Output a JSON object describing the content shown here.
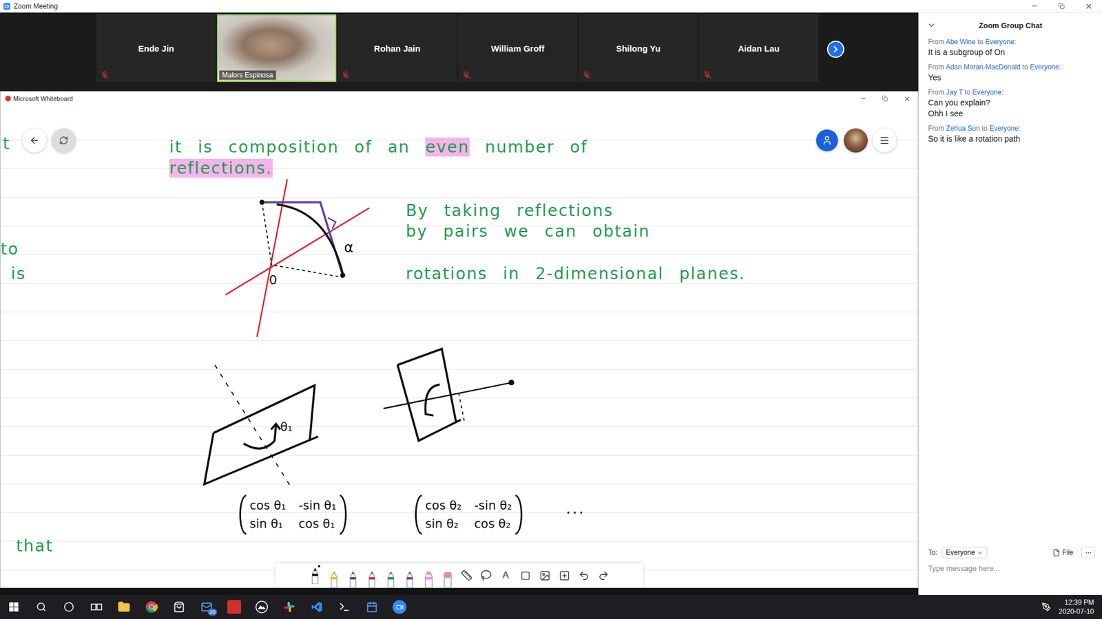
{
  "window": {
    "title": "Zoom Meeting"
  },
  "participants": [
    {
      "name": "Ende Jin",
      "muted": true,
      "video": false,
      "speaking": false
    },
    {
      "name": "Malors Espinosa",
      "muted": false,
      "video": true,
      "speaking": true
    },
    {
      "name": "Rohan Jain",
      "muted": true,
      "video": false,
      "speaking": false
    },
    {
      "name": "William Groff",
      "muted": true,
      "video": false,
      "speaking": false
    },
    {
      "name": "Shilong Yu",
      "muted": true,
      "video": false,
      "speaking": false
    },
    {
      "name": "Aidan Lau",
      "muted": true,
      "video": false,
      "speaking": false
    }
  ],
  "whiteboard": {
    "title": "Microsoft Whiteboard",
    "notes": [
      {
        "segments": [
          {
            "text": "t",
            "highlighted": false
          }
        ]
      },
      {
        "segments": [
          {
            "text": "it is composition of an",
            "highlighted": false
          },
          {
            "text": "even",
            "highlighted": true
          },
          {
            "text": "number of",
            "highlighted": false
          }
        ]
      },
      {
        "segments": [
          {
            "text": "reflections.",
            "highlighted": true
          }
        ]
      },
      {
        "segments": [
          {
            "text": "to",
            "highlighted": false
          }
        ]
      },
      {
        "segments": [
          {
            "text": "is",
            "highlighted": false
          }
        ]
      },
      {
        "segments": [
          {
            "text": "By taking reflections",
            "highlighted": false
          }
        ]
      },
      {
        "segments": [
          {
            "text": "by pairs we can obtain",
            "highlighted": false
          }
        ]
      },
      {
        "segments": [
          {
            "text": "rotations in 2-dimensional planes.",
            "highlighted": false
          }
        ]
      },
      {
        "segments": [
          {
            "text": "that",
            "highlighted": false
          }
        ]
      }
    ],
    "diagram_labels": {
      "angle": "α",
      "origin": "0",
      "rotation": "θ₁"
    },
    "matrices": [
      {
        "cells": [
          "cos θ₁",
          "-sin θ₁",
          "sin θ₁",
          "cos θ₁"
        ]
      },
      {
        "cells": [
          "cos θ₂",
          "-sin θ₂",
          "sin θ₂",
          "cos θ₂"
        ]
      }
    ],
    "ellipsis": "...",
    "tools": {
      "pens": [
        {
          "kind": "pen",
          "color": "#111111",
          "selected": true
        },
        {
          "kind": "pen",
          "color": "#f2c200",
          "selected": false
        },
        {
          "kind": "pen",
          "color": "#5b3fa6",
          "selected": false
        },
        {
          "kind": "pen",
          "color": "#d92a2a",
          "selected": false
        },
        {
          "kind": "pen",
          "color": "#1e9e4e",
          "selected": false
        },
        {
          "kind": "pen",
          "color": "#7b3fb0",
          "selected": false
        },
        {
          "kind": "highlighter",
          "color": "#f08fd8",
          "selected": false
        },
        {
          "kind": "eraser",
          "color": "#e88aa8",
          "selected": false
        }
      ],
      "text_tool": "A"
    }
  },
  "chat": {
    "title": "Zoom Group Chat",
    "from_label": "From",
    "to_label": "to",
    "messages": [
      {
        "sender": "Abe Wine",
        "recipient": "Everyone:",
        "lines": [
          "It is a subgroup of On"
        ]
      },
      {
        "sender": "Adan Moran-MacDonald",
        "recipient": "Everyone:",
        "lines": [
          "Yes"
        ]
      },
      {
        "sender": "Jay T",
        "recipient": "Everyone:",
        "lines": [
          "Can you explain?",
          "Ohh I see"
        ]
      },
      {
        "sender": "Zehua Sun",
        "recipient": "Everyone:",
        "lines": [
          "So it is like a rotation path"
        ]
      }
    ],
    "composer": {
      "to_label": "To:",
      "recipient": "Everyone",
      "file_label": "File",
      "placeholder": "Type message here..."
    }
  },
  "taskbar": {
    "mail_badge": "20",
    "time": "12:39 PM",
    "date": "2020-07-10"
  }
}
